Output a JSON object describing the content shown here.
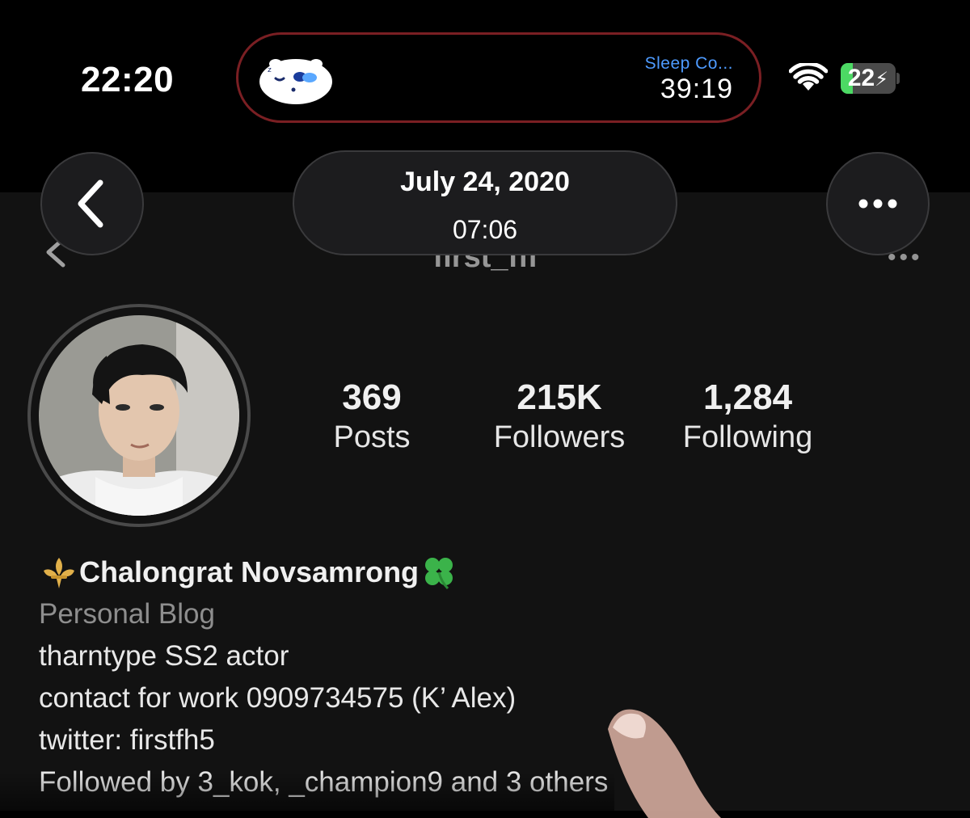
{
  "status_bar": {
    "time": "22:20",
    "live_activity": {
      "app_icon": "sleeping-seal-icon",
      "label": "Sleep Co...",
      "timer": "39:19",
      "border_color": "#7a1f23"
    },
    "wifi_icon": "wifi-icon",
    "battery": {
      "percent": "22",
      "level": 0.22,
      "charging": true,
      "fill_color": "#4cd964"
    }
  },
  "viewer": {
    "back_icon": "chevron-left-icon",
    "date": "July 24, 2020",
    "time": "07:06",
    "more_icon": "ellipsis-icon"
  },
  "profile": {
    "username": "first_ffi",
    "stats": [
      {
        "value": "369",
        "label": "Posts"
      },
      {
        "value": "215K",
        "label": "Followers"
      },
      {
        "value": "1,284",
        "label": "Following"
      }
    ],
    "name": "Chalongrat Novsamrong",
    "name_prefix_icon": "fleur-de-lis-icon",
    "name_suffix_icon": "four-leaf-clover-icon",
    "category": "Personal Blog",
    "bio_lines": [
      "tharntype SS2 actor",
      "contact for work 0909734575 (K’ Alex)",
      "twitter: firstfh5"
    ],
    "followed_by": "Followed by 3_kok, _champion9 and 3 others"
  },
  "colors": {
    "background": "#121212",
    "status_bar": "#000000",
    "category_text": "#8e8e8e",
    "accent_blue": "#4e9bff"
  }
}
